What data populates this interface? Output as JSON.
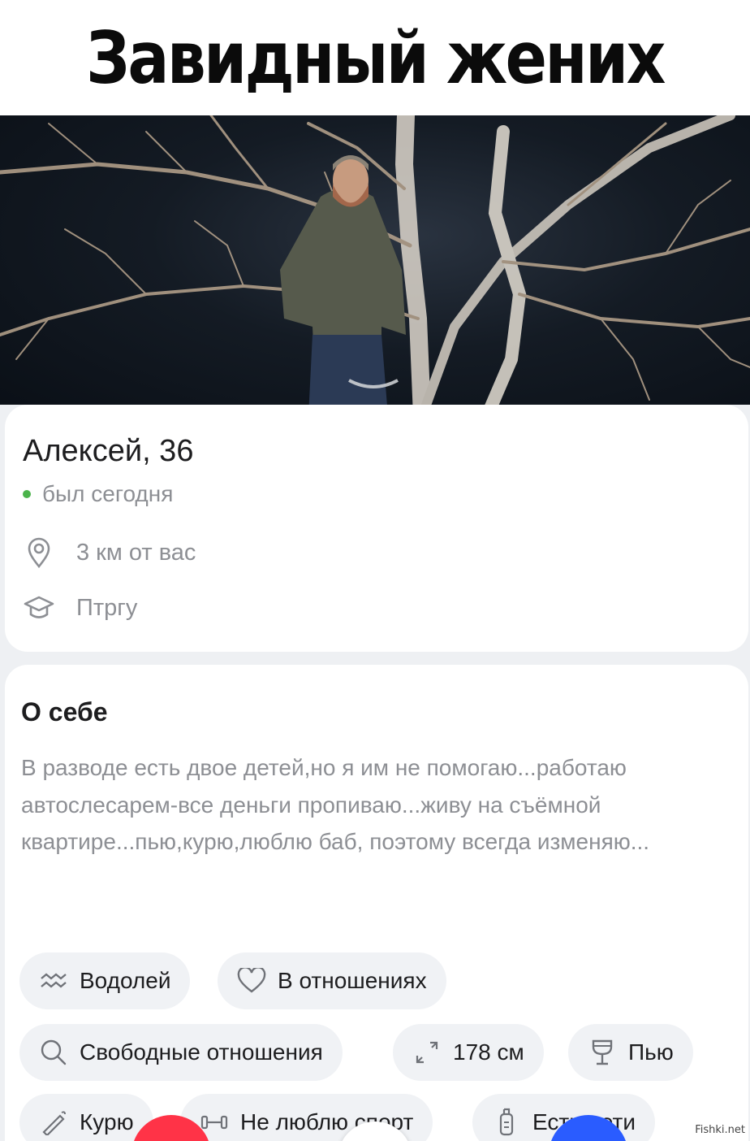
{
  "meme_title": "Завидный жених",
  "profile": {
    "name_age": "Алексей, 36",
    "status": "был сегодня",
    "status_color": "#4bb34b",
    "distance": "3 км от вас",
    "education": "Птргу"
  },
  "about": {
    "title": "О себе",
    "text": "В разводе есть двое детей,но я им не помогаю...работаю автослесарем-все деньги пропиваю...живу на съёмной квартире...пью,курю,люблю баб, поэтому всегда изменяю..."
  },
  "chips": [
    {
      "icon": "aquarius-icon",
      "label": "Водолей"
    },
    {
      "icon": "heart-icon",
      "label": "В отношениях"
    },
    {
      "icon": "search-icon",
      "label": "Свободные отношения"
    },
    {
      "icon": "height-arrows-icon",
      "label": "178 см"
    },
    {
      "icon": "wine-glass-icon",
      "label": "Пью"
    },
    {
      "icon": "cigarette-icon",
      "label": "Курю"
    },
    {
      "icon": "dumbbell-icon",
      "label": "Не люблю спорт"
    },
    {
      "icon": "baby-bottle-icon",
      "label": "Есть дети"
    }
  ],
  "actions": {
    "dislike_color": "#ff3347",
    "like_color": "#2a5cff"
  },
  "watermark": "Fishki.net"
}
